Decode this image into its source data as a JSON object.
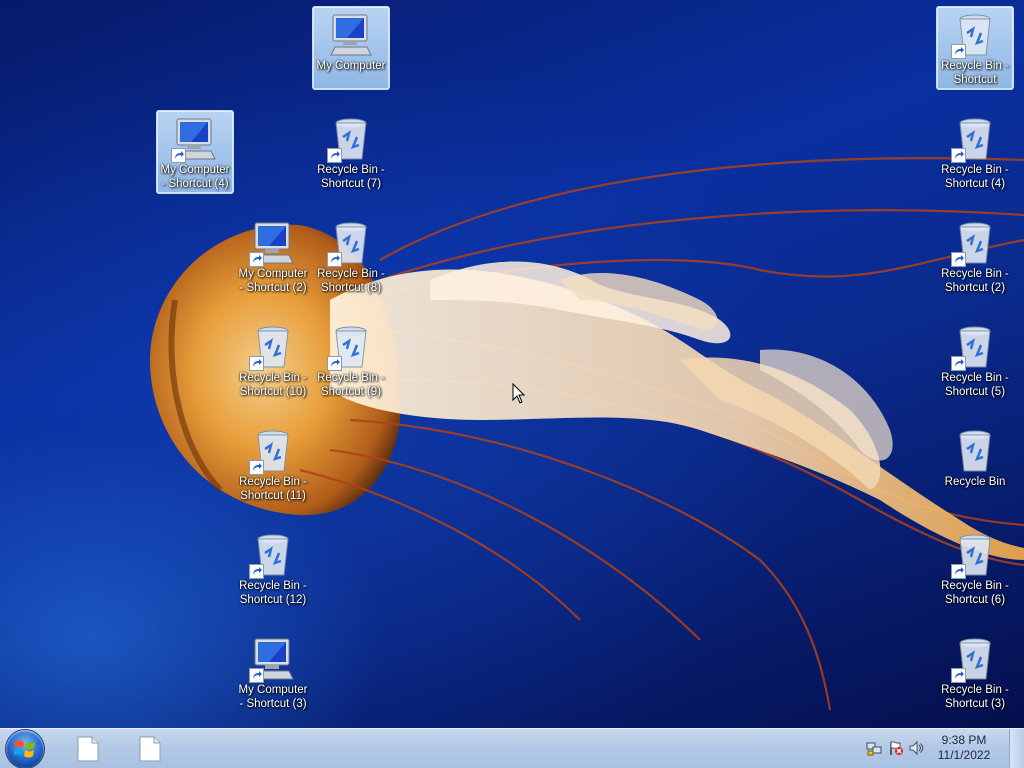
{
  "desktop": {
    "icons": [
      {
        "label": "My Computer",
        "type": "computer",
        "shortcut": false,
        "selected": true
      },
      {
        "label": "Recycle Bin - Shortcut",
        "type": "recycle",
        "shortcut": true,
        "selected": true
      },
      {
        "label": "My Computer - Shortcut (4)",
        "type": "computer",
        "shortcut": true,
        "selected": true
      },
      {
        "label": "Recycle Bin - Shortcut (7)",
        "type": "recycle",
        "shortcut": true,
        "selected": false
      },
      {
        "label": "Recycle Bin - Shortcut (4)",
        "type": "recycle",
        "shortcut": true,
        "selected": false
      },
      {
        "label": "My Computer - Shortcut (2)",
        "type": "computer",
        "shortcut": true,
        "selected": false
      },
      {
        "label": "Recycle Bin - Shortcut (8)",
        "type": "recycle",
        "shortcut": true,
        "selected": false
      },
      {
        "label": "Recycle Bin - Shortcut (2)",
        "type": "recycle",
        "shortcut": true,
        "selected": false
      },
      {
        "label": "Recycle Bin - Shortcut (10)",
        "type": "recycle",
        "shortcut": true,
        "selected": false
      },
      {
        "label": "Recycle Bin - Shortcut (9)",
        "type": "recycle",
        "shortcut": true,
        "selected": false
      },
      {
        "label": "Recycle Bin - Shortcut (5)",
        "type": "recycle",
        "shortcut": true,
        "selected": false
      },
      {
        "label": "Recycle Bin - Shortcut (11)",
        "type": "recycle",
        "shortcut": true,
        "selected": false
      },
      {
        "label": "Recycle Bin",
        "type": "recycle",
        "shortcut": false,
        "selected": false
      },
      {
        "label": "Recycle Bin - Shortcut (12)",
        "type": "recycle",
        "shortcut": true,
        "selected": false
      },
      {
        "label": "Recycle Bin - Shortcut (6)",
        "type": "recycle",
        "shortcut": true,
        "selected": false
      },
      {
        "label": "My Computer - Shortcut (3)",
        "type": "computer",
        "shortcut": true,
        "selected": false
      },
      {
        "label": "Recycle Bin - Shortcut (3)",
        "type": "recycle",
        "shortcut": true,
        "selected": false
      }
    ]
  },
  "taskbar": {
    "start_icon": "windows-logo-icon",
    "buttons": [
      {
        "icon": "document-icon"
      },
      {
        "icon": "document-icon"
      }
    ],
    "tray": {
      "icons": [
        "network-icon",
        "action-center-flag-icon",
        "volume-icon"
      ],
      "clock_time": "9:38 PM",
      "clock_date": "11/1/2022"
    }
  },
  "colors": {
    "taskbar": "#b3c9e6",
    "desktop_deep_blue": "#0a2fa0",
    "jellyfish_orange": "#e89a2a"
  }
}
